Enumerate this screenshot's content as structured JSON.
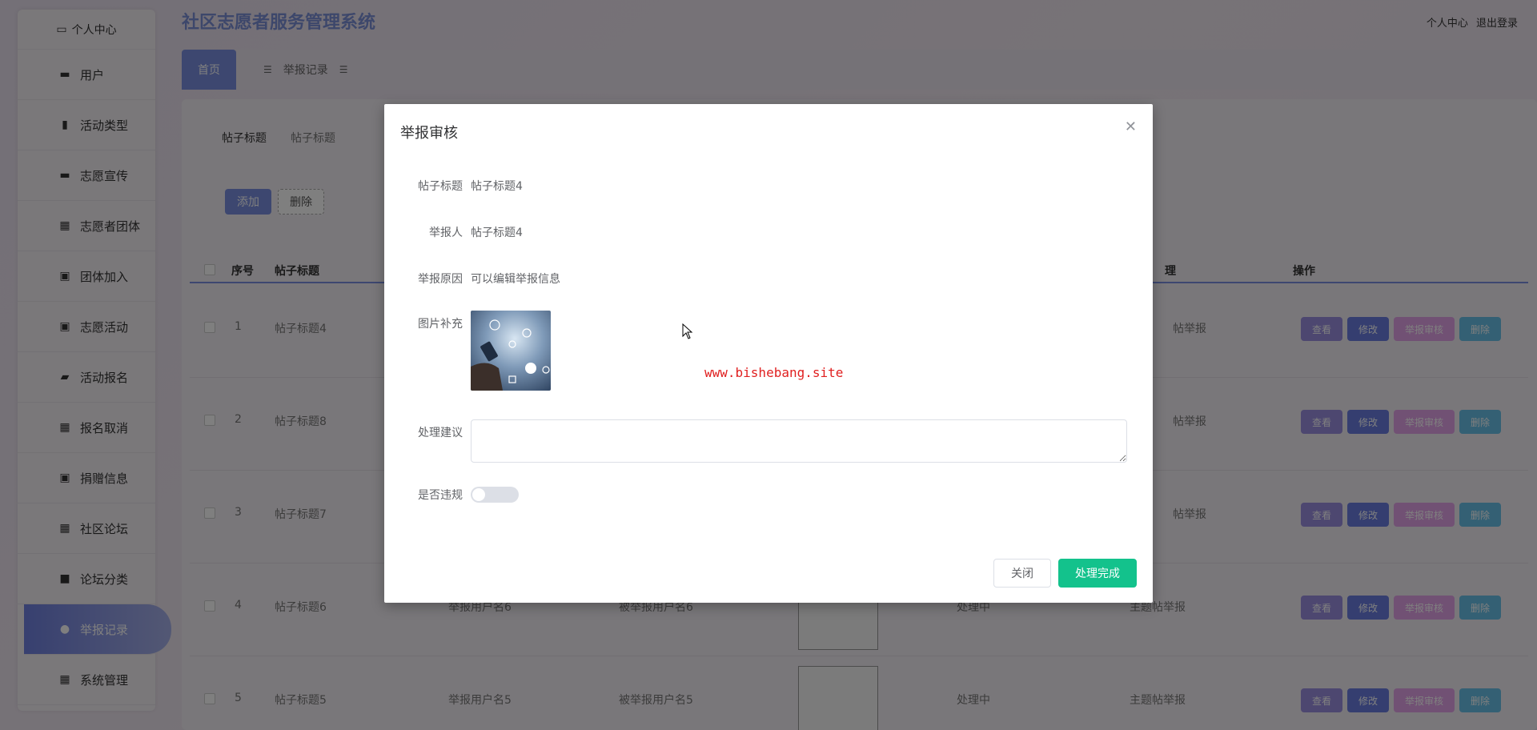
{
  "header": {
    "system_title": "社区志愿者服务管理系统",
    "profile_link": "个人中心",
    "logout_link": "退出登录"
  },
  "sidebar": {
    "top_label": "个人中心",
    "items": [
      {
        "label": "用户",
        "icon": "briefcase-icon"
      },
      {
        "label": "活动类型",
        "icon": "bookmark-icon"
      },
      {
        "label": "志愿宣传",
        "icon": "briefcase-icon"
      },
      {
        "label": "志愿者团体",
        "icon": "grid-icon"
      },
      {
        "label": "团体加入",
        "icon": "clipboard-icon"
      },
      {
        "label": "志愿活动",
        "icon": "clipboard-icon"
      },
      {
        "label": "活动报名",
        "icon": "chat-icon"
      },
      {
        "label": "报名取消",
        "icon": "grid-icon"
      },
      {
        "label": "捐赠信息",
        "icon": "clipboard-x-icon"
      },
      {
        "label": "社区论坛",
        "icon": "grid-icon"
      },
      {
        "label": "论坛分类",
        "icon": "video-icon"
      },
      {
        "label": "举报记录",
        "icon": "user-icon",
        "active": true
      },
      {
        "label": "系统管理",
        "icon": "grid-icon"
      }
    ]
  },
  "tabs": [
    {
      "label": "首页",
      "active": true
    },
    {
      "label": "举报记录",
      "active": false
    }
  ],
  "search": {
    "label": "帖子标题",
    "placeholder": "帖子标题"
  },
  "toolbar": {
    "add_label": "添加",
    "delete_label": "删除"
  },
  "table": {
    "headers": {
      "index": "序号",
      "title": "帖子标题",
      "handle": "理",
      "ops": "操作"
    },
    "rows": [
      {
        "index": "1",
        "title": "帖子标题4",
        "reporter": "",
        "reported": "",
        "status": "",
        "type": "帖举报"
      },
      {
        "index": "2",
        "title": "帖子标题8",
        "reporter": "",
        "reported": "",
        "status": "",
        "type": "帖举报"
      },
      {
        "index": "3",
        "title": "帖子标题7",
        "reporter": "",
        "reported": "",
        "status": "",
        "type": "帖举报"
      },
      {
        "index": "4",
        "title": "帖子标题6",
        "reporter": "举报用户名6",
        "reported": "被举报用户名6",
        "status": "处理中",
        "type": "主题帖举报"
      },
      {
        "index": "5",
        "title": "帖子标题5",
        "reporter": "举报用户名5",
        "reported": "被举报用户名5",
        "status": "处理中",
        "type": "主题帖举报"
      }
    ],
    "op_labels": {
      "view": "查看",
      "edit": "修改",
      "audit": "举报审核",
      "delete": "删除"
    }
  },
  "modal": {
    "title": "举报审核",
    "fields": {
      "title_label": "帖子标题",
      "title_value": "帖子标题4",
      "reporter_label": "举报人",
      "reporter_value": "帖子标题4",
      "reason_label": "举报原因",
      "reason_value": "可以编辑举报信息",
      "image_label": "图片补充",
      "suggest_label": "处理建议",
      "suggest_value": "",
      "violation_label": "是否违规",
      "violation_on": false
    },
    "watermark": "www.bishebang.site",
    "close_button": "关闭",
    "done_button": "处理完成"
  },
  "colors": {
    "primary": "#7b8fe0",
    "success": "#13c28c",
    "watermark": "#e02020"
  }
}
